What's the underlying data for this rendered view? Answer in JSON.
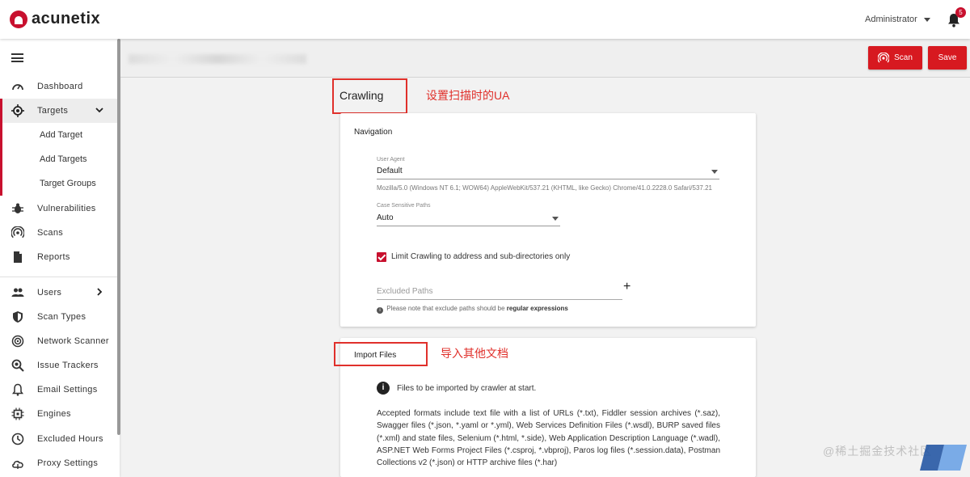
{
  "app": {
    "brand": "acunetix"
  },
  "topbar": {
    "user": "Administrator",
    "notification_count": "5"
  },
  "sidebar": {
    "items": [
      {
        "label": "Dashboard",
        "icon": "dashboard-icon"
      },
      {
        "label": "Targets",
        "icon": "target-icon",
        "active": true
      },
      {
        "label": "Vulnerabilities",
        "icon": "bug-icon"
      },
      {
        "label": "Scans",
        "icon": "scan-icon"
      },
      {
        "label": "Reports",
        "icon": "report-icon"
      },
      {
        "label": "Users",
        "icon": "users-icon"
      },
      {
        "label": "Scan Types",
        "icon": "shield-icon"
      },
      {
        "label": "Network Scanner",
        "icon": "network-icon"
      },
      {
        "label": "Issue Trackers",
        "icon": "tracker-icon"
      },
      {
        "label": "Email Settings",
        "icon": "bell-icon"
      },
      {
        "label": "Engines",
        "icon": "engine-icon"
      },
      {
        "label": "Excluded Hours",
        "icon": "clock-icon"
      },
      {
        "label": "Proxy Settings",
        "icon": "cloud-icon"
      }
    ],
    "subitems": [
      "Add Target",
      "Add Targets",
      "Target Groups"
    ]
  },
  "header": {
    "scan_label": "Scan",
    "save_label": "Save"
  },
  "crawling": {
    "title": "Crawling",
    "annotation": "设置扫描时的UA",
    "navigation_title": "Navigation",
    "user_agent_label": "User Agent",
    "user_agent_value": "Default",
    "ua_string": "Mozilla/5.0 (Windows NT 6.1; WOW64) AppleWebKit/537.21 (KHTML, like Gecko) Chrome/41.0.2228.0 Safari/537.21",
    "case_label": "Case Sensitive Paths",
    "case_value": "Auto",
    "limit_label": "Limit Crawling to address and sub-directories only",
    "limit_checked": true,
    "excluded_placeholder": "Excluded Paths",
    "note_prefix": "Please note that exclude paths should be",
    "note_bold": "regular expressions"
  },
  "import": {
    "title": "Import Files",
    "annotation": "导入其他文档",
    "info": "Files to be imported by crawler at start.",
    "desc": "Accepted formats include text file with a list of URLs (*.txt), Fiddler session archives (*.saz), Swagger files (*.json, *.yaml or *.yml), Web Services Definition Files (*.wsdl), BURP saved files (*.xml) and state files, Selenium (*.html, *.side), Web Application Description Language (*.wadl), ASP.NET Web Forms Project Files (*.csproj, *.vbproj), Paros log files (*.session.data), Postman Collections v2 (*.json) or HTTP archive files (*.har)"
  },
  "watermark": {
    "text": "@稀土掘金技术社区"
  },
  "colors": {
    "accent": "#d71920",
    "annotation": "#e0302b"
  }
}
